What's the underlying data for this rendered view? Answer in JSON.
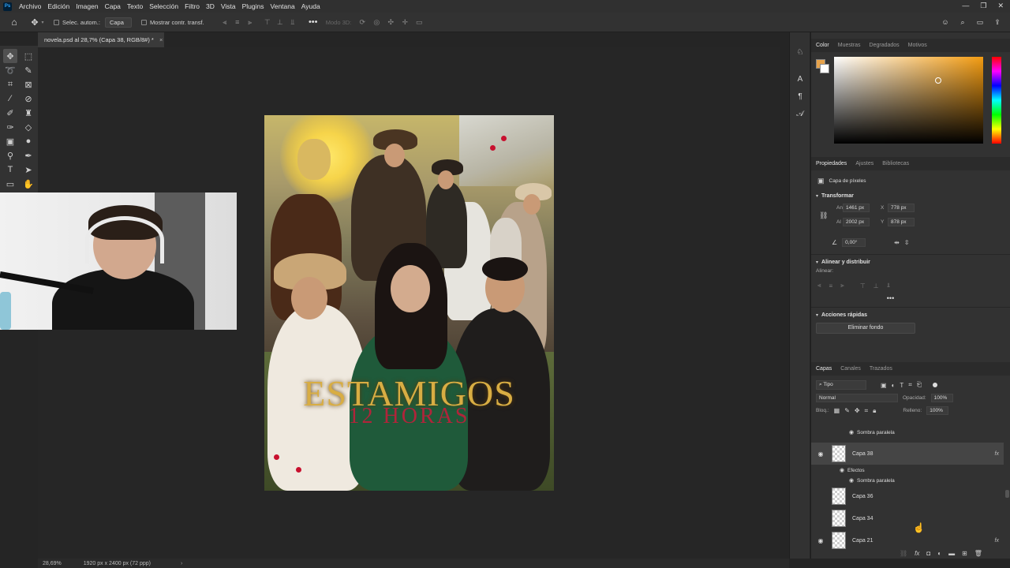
{
  "menubar": {
    "app_icon": "Ps",
    "items": [
      "Archivo",
      "Edición",
      "Imagen",
      "Capa",
      "Texto",
      "Selección",
      "Filtro",
      "3D",
      "Vista",
      "Plugins",
      "Ventana",
      "Ayuda"
    ]
  },
  "options": {
    "auto_select_label": "Selec. autom.:",
    "auto_select_value": "Capa",
    "show_transform_label": "Mostrar contr. transf.",
    "mode3d_label": "Modo 3D:"
  },
  "document": {
    "tab_title": "novela.psd al 28,7% (Capa 38, RGB/8#) *"
  },
  "poster": {
    "title": "ESTAMIGOS",
    "subtitle": "12 HORAS"
  },
  "panels": {
    "color_tabs": [
      "Color",
      "Muestras",
      "Degradados",
      "Motivos"
    ],
    "props_tabs": [
      "Propiedades",
      "Ajustes",
      "Bibliotecas"
    ],
    "layer_kind": "Capa de píxeles",
    "transform_title": "Transformar",
    "width_label": "An",
    "width_value": "1461 px",
    "height_label": "Al",
    "height_value": "2002 px",
    "x_label": "X",
    "x_value": "778 px",
    "y_label": "Y",
    "y_value": "878 px",
    "angle_value": "0,00°",
    "align_title": "Alinear y distribuir",
    "align_sub": "Alinear:",
    "quick_actions_title": "Acciones rápidas",
    "remove_bg_button": "Eliminar fondo"
  },
  "layers": {
    "tabs": [
      "Capas",
      "Canales",
      "Trazados"
    ],
    "filter_value": "Tipo",
    "blend_mode": "Normal",
    "opacity_label": "Opacidad:",
    "opacity_value": "100%",
    "lock_label": "Bloq.:",
    "fill_label": "Relleno:",
    "fill_value": "100%",
    "rows": [
      {
        "type": "effect",
        "label": "Sombra paralela"
      },
      {
        "type": "layer",
        "label": "Capa 38",
        "fx": "fx",
        "visible": true,
        "selected": true
      },
      {
        "type": "effects-header",
        "label": "Efectos"
      },
      {
        "type": "effect",
        "label": "Sombra paralela"
      },
      {
        "type": "layer",
        "label": "Capa 36",
        "visible": false
      },
      {
        "type": "layer",
        "label": "Capa 34",
        "visible": false
      },
      {
        "type": "layer",
        "label": "Capa 21",
        "fx": "fx",
        "visible": true
      }
    ]
  },
  "status": {
    "zoom": "28,69%",
    "doc_size": "1920 px x 2400 px (72 ppp)"
  },
  "colors": {
    "foreground": "#e6a24a",
    "accent": "#f39c12",
    "app_bg": "#252525",
    "panel_bg": "#323232"
  }
}
